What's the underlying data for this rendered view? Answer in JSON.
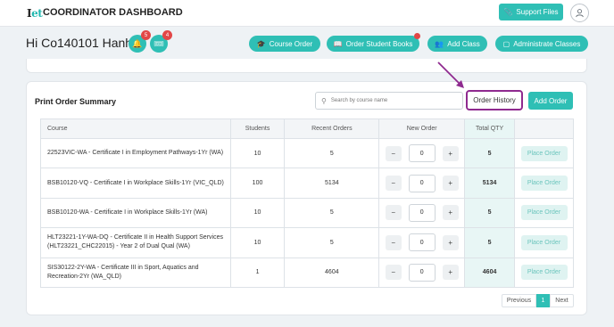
{
  "app": {
    "logo_main": "I",
    "logo_accent": "et",
    "title": "COORDINATOR DASHBOARD"
  },
  "header": {
    "support_label": "Support Files",
    "support_icon": "paperclip-icon",
    "avatar_icon": "user-icon"
  },
  "greeting": "Hi Co140101 Hanh!",
  "alerts": [
    {
      "icon": "bell-icon",
      "count": "5"
    },
    {
      "icon": "ticket-icon",
      "count": "4"
    }
  ],
  "nav": {
    "course_order": "Course Order",
    "order_student_books": "Order Student Books",
    "add_class": "Add Class",
    "administrate_classes": "Administrate Classes"
  },
  "summary": {
    "title": "Print Order Summary",
    "search_placeholder": "Search by course name",
    "order_history": "Order History",
    "add_order": "Add Order"
  },
  "table": {
    "headers": [
      "Course",
      "Students",
      "Recent Orders",
      "New Order",
      "Total QTY",
      ""
    ],
    "place_label": "Place Order",
    "rows": [
      {
        "course": "22523VIC-WA - Certificate I in Employment Pathways-1Yr (WA)",
        "students": "10",
        "recent": "5",
        "new": "0",
        "total": "5"
      },
      {
        "course": "BSB10120-VQ - Certificate I in Workplace Skills-1Yr (VIC_QLD)",
        "students": "100",
        "recent": "5134",
        "new": "0",
        "total": "5134"
      },
      {
        "course": "BSB10120-WA - Certificate I in Workplace Skills-1Yr (WA)",
        "students": "10",
        "recent": "5",
        "new": "0",
        "total": "5"
      },
      {
        "course": "HLT23221-1Y-WA-DQ - Certificate II in Health Support Services (HLT23221_CHC22015) - Year 2 of Dual Qual (WA)",
        "students": "10",
        "recent": "5",
        "new": "0",
        "total": "5"
      },
      {
        "course": "SIS30122-2Y-WA - Certificate III in Sport, Aquatics and Recreation-2Yr (WA_QLD)",
        "students": "1",
        "recent": "4604",
        "new": "0",
        "total": "4604"
      }
    ]
  },
  "pagination": {
    "previous": "Previous",
    "current": "1",
    "next": "Next"
  },
  "colors": {
    "accent": "#2fbfb5",
    "highlight": "#8f2a8f",
    "badge": "#e24747"
  }
}
